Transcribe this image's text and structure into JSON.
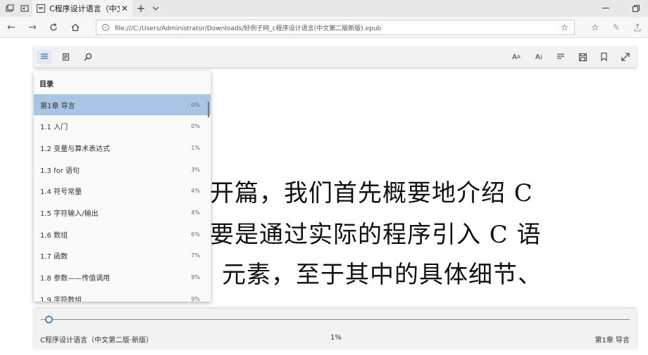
{
  "browser": {
    "tab_title": "C程序设计语言（中文第",
    "address": "file:///C:/Users/Administrator/Downloads/好例子网_c程序设计语言(中文第二版新版).epub"
  },
  "toc": {
    "heading": "目录",
    "items": [
      {
        "label": "第1章 导言",
        "pct": "0%"
      },
      {
        "label": "1.1 入门",
        "pct": "0%"
      },
      {
        "label": "1.2 变量与算术表达式",
        "pct": "1%"
      },
      {
        "label": "1.3 for 语句",
        "pct": "3%"
      },
      {
        "label": "1.4 符号常量",
        "pct": "4%"
      },
      {
        "label": "1.5 字符输入/输出",
        "pct": "4%"
      },
      {
        "label": "1.6 数组",
        "pct": "6%"
      },
      {
        "label": "1.7 函数",
        "pct": "7%"
      },
      {
        "label": "1.8 参数——传值调用",
        "pct": "9%"
      },
      {
        "label": "1.9 字符数组",
        "pct": "9%"
      }
    ]
  },
  "content": {
    "lines": [
      "开篇，我们首先概要地介绍  C",
      "要是通过实际的程序引入 C 语",
      "元素，至于其中的具体细节、"
    ]
  },
  "footer": {
    "book_title": "C程序设计语言（中文第二版·新版）",
    "progress": "1%",
    "progress_value": 0.01,
    "chapter": "第1章 导言"
  },
  "colors": {
    "selected_item": "#a9c5e6",
    "slider_accent": "#4a86c8"
  }
}
